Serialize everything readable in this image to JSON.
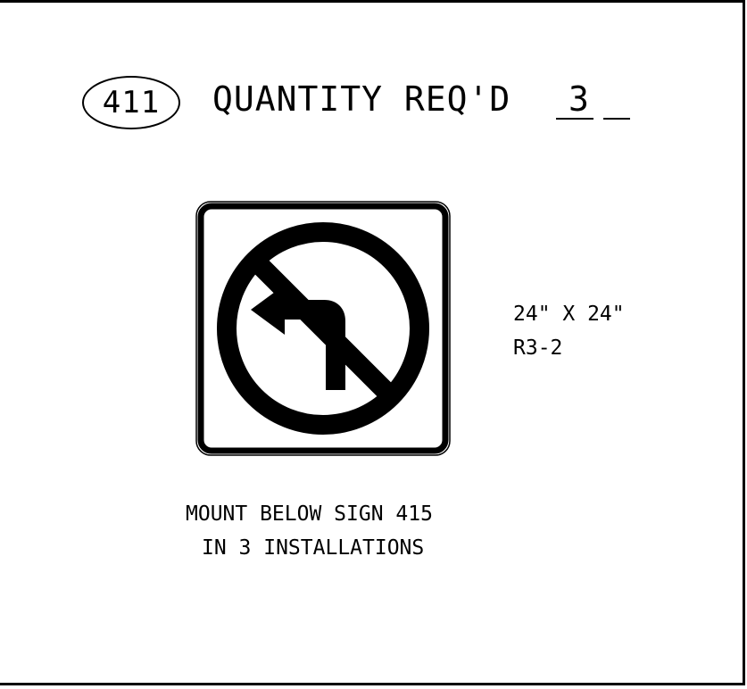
{
  "header": {
    "sign_number": "411",
    "quantity_label": "QUANTITY REQ'D",
    "quantity_value": "3"
  },
  "sign": {
    "icon": "no-left-turn-icon",
    "size": "24\" X 24\"",
    "code": "R3-2"
  },
  "notes": {
    "line1": "MOUNT BELOW SIGN 415",
    "line2": "IN 3 INSTALLATIONS"
  }
}
